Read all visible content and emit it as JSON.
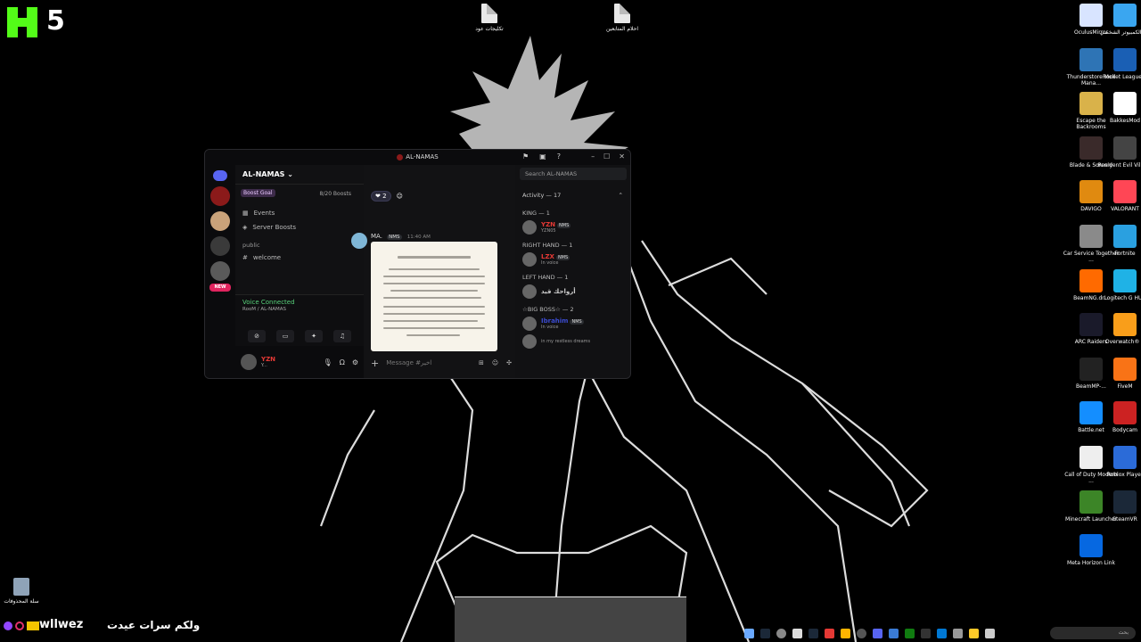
{
  "overlay": {
    "kick_count": "5",
    "stream_name": "wllwez",
    "stream_arabic": "ولكم سرات عيدت"
  },
  "desktop_top_icons": [
    {
      "label": "تكليجات عود"
    },
    {
      "label": "احلام المتابعين"
    }
  ],
  "desktop_right_icons": [
    {
      "label": "OculusMirror",
      "color": "#d8e4ff"
    },
    {
      "label": "هذا الكمبيوتر الشخصي",
      "color": "#3aa6f0"
    },
    {
      "label": "Thunderstore Mod Mana...",
      "color": "#2e74b5"
    },
    {
      "label": "Rocket League®",
      "color": "#1a5fb4"
    },
    {
      "label": "Escape the Backrooms",
      "color": "#d9b24a"
    },
    {
      "label": "BakkesMod",
      "color": "#ffffff"
    },
    {
      "label": "Blade & Sorcery",
      "color": "#3a2a2a"
    },
    {
      "label": "Resident Evil Village",
      "color": "#444444"
    },
    {
      "label": "DAVIGO",
      "color": "#e08a10"
    },
    {
      "label": "VALORANT",
      "color": "#ff4655"
    },
    {
      "label": "Car Service Together ...",
      "color": "#8a8a8a"
    },
    {
      "label": "Fortnite",
      "color": "#2aa0e0"
    },
    {
      "label": "BeamNG.dr...",
      "color": "#ff6a00"
    },
    {
      "label": "Logitech G HUB",
      "color": "#1fb2e6"
    },
    {
      "label": "ARC Raiders",
      "color": "#1a1a2a"
    },
    {
      "label": "Overwatch® 2",
      "color": "#f99e1a"
    },
    {
      "label": "BeamMP-...",
      "color": "#222222"
    },
    {
      "label": "FiveM",
      "color": "#f97316"
    },
    {
      "label": "Battle.net",
      "color": "#148eff"
    },
    {
      "label": "Bodycam",
      "color": "#cc2222"
    },
    {
      "label": "Call of Duty Modern ...",
      "color": "#eeeeee"
    },
    {
      "label": "Roblox Player",
      "color": "#2b6bd8"
    },
    {
      "label": "Minecraft Launcher",
      "color": "#3c8527"
    },
    {
      "label": "SteamVR",
      "color": "#1b2838"
    },
    {
      "label": "Meta Horizon Link",
      "color": "#0668e1"
    }
  ],
  "recycle_bin": {
    "label": "سلة المحذوفات"
  },
  "discord": {
    "title": "AL-NAMAS",
    "server_name": "AL-NAMAS",
    "channel_name": "اخير",
    "search_placeholder": "Search AL-NAMAS",
    "boost_goal": "Boost Goal",
    "boost_count": "8/20 Boosts",
    "sidebar_items": [
      {
        "label": "Events"
      },
      {
        "label": "Server Boosts"
      }
    ],
    "category": "public",
    "channel": "welcome",
    "new_badge": "NEW",
    "voice_status": "Voice Connected",
    "voice_room": "RooM / AL-NAMAS",
    "user_name": "YZN",
    "user_status": "Y...",
    "reaction_count": "2",
    "message_author": "MA.",
    "message_tag": "NMS",
    "message_time": "11:40 AM",
    "composer_placeholder": "Message #اخير",
    "activity_header": "Activity — 17",
    "roles": [
      {
        "name": "KING — 1",
        "members": [
          {
            "name": "YZN",
            "sub": "YZN05",
            "tag": "NMS",
            "color": "#e53935"
          }
        ]
      },
      {
        "name": "RIGHT HAND — 1",
        "members": [
          {
            "name": "LZX",
            "sub": "In voice",
            "tag": "NMS",
            "color": "#e53935"
          }
        ]
      },
      {
        "name": "LEFT HAND — 1",
        "members": [
          {
            "name": "أرواحك قيد",
            "sub": "",
            "tag": "",
            "color": "#cccccc"
          }
        ]
      },
      {
        "name": "☆BIG BOSS☆ — 2",
        "members": [
          {
            "name": "Ibrahim",
            "sub": "In voice",
            "tag": "NMS",
            "color": "#3b4bd0"
          },
          {
            "name": "",
            "sub": "in my restless dreams",
            "tag": "",
            "color": "#3b4bd0"
          }
        ]
      }
    ]
  },
  "taskbar": {
    "search": "بحث"
  }
}
